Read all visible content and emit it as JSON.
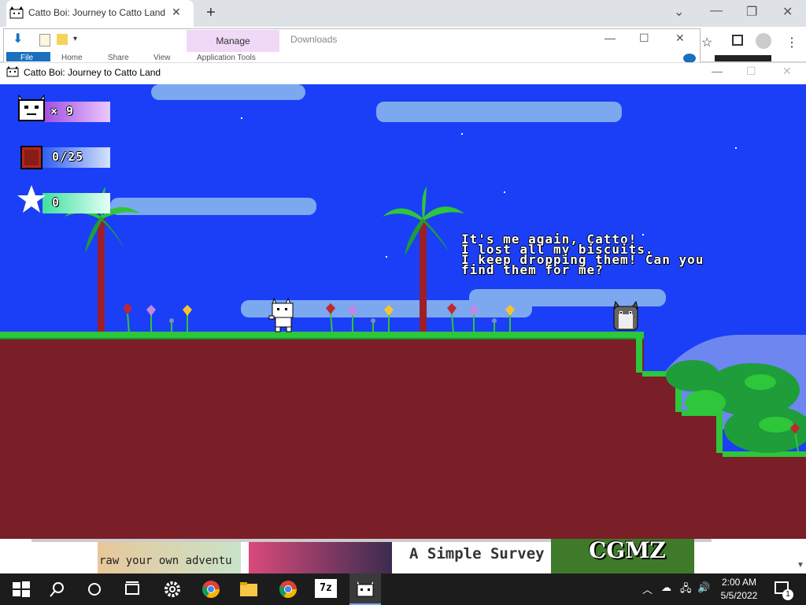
{
  "browser": {
    "tab_title": "Catto Boi: Journey to Catto Land",
    "tab_close": "✕",
    "new_tab": "+",
    "controls": {
      "chevron": "⌄",
      "minimize": "—",
      "restore": "❐",
      "close": "✕"
    }
  },
  "explorer": {
    "manage_label": "Manage",
    "downloads_label": "Downloads",
    "file_tab": "File",
    "ribbon_tabs": [
      "Home",
      "Share",
      "View",
      "Application Tools"
    ]
  },
  "game_window": {
    "title": "Catto Boi: Journey to Catto Land"
  },
  "hud": {
    "lives": "× 9",
    "biscuits": "0/25",
    "stars": "0"
  },
  "dialogue": {
    "lines": [
      "It's me again, Catto!",
      "I lost all my biscuits.",
      "I keep dropping them! Can you",
      "find them for me?"
    ]
  },
  "page_strip": {
    "draw_text": "raw your own adventu",
    "survey_text": "A Simple Survey",
    "cgmz_text": "CGMZ"
  },
  "taskbar": {
    "clock_time": "2:00 AM",
    "clock_date": "5/5/2022",
    "notification_count": "1"
  },
  "colors": {
    "sky": "#1b3ff6",
    "cloud": "#7ca8ef",
    "ground": "#7a1f27",
    "grass": "#2ec63a",
    "bush": "#1e9d3a",
    "hill": "#6e86f0"
  }
}
